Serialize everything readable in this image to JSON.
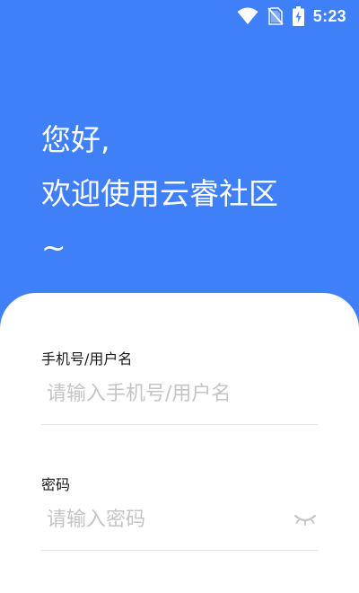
{
  "status_bar": {
    "time": "5:23",
    "icons": [
      "wifi-icon",
      "no-sim-icon",
      "battery-charging-icon"
    ]
  },
  "greeting": {
    "line1": "您好,",
    "line2": "欢迎使用云睿社区",
    "line3": "~"
  },
  "form": {
    "username": {
      "label": "手机号/用户名",
      "placeholder": "请输入手机号/用户名",
      "value": ""
    },
    "password": {
      "label": "密码",
      "placeholder": "请输入密码",
      "value": "",
      "toggle_icon": "eye-closed-icon"
    }
  },
  "colors": {
    "header_background": "#3F7FF7",
    "card_background": "#FFFFFF",
    "placeholder": "#C4C4C4",
    "divider": "#E6E6E6"
  }
}
